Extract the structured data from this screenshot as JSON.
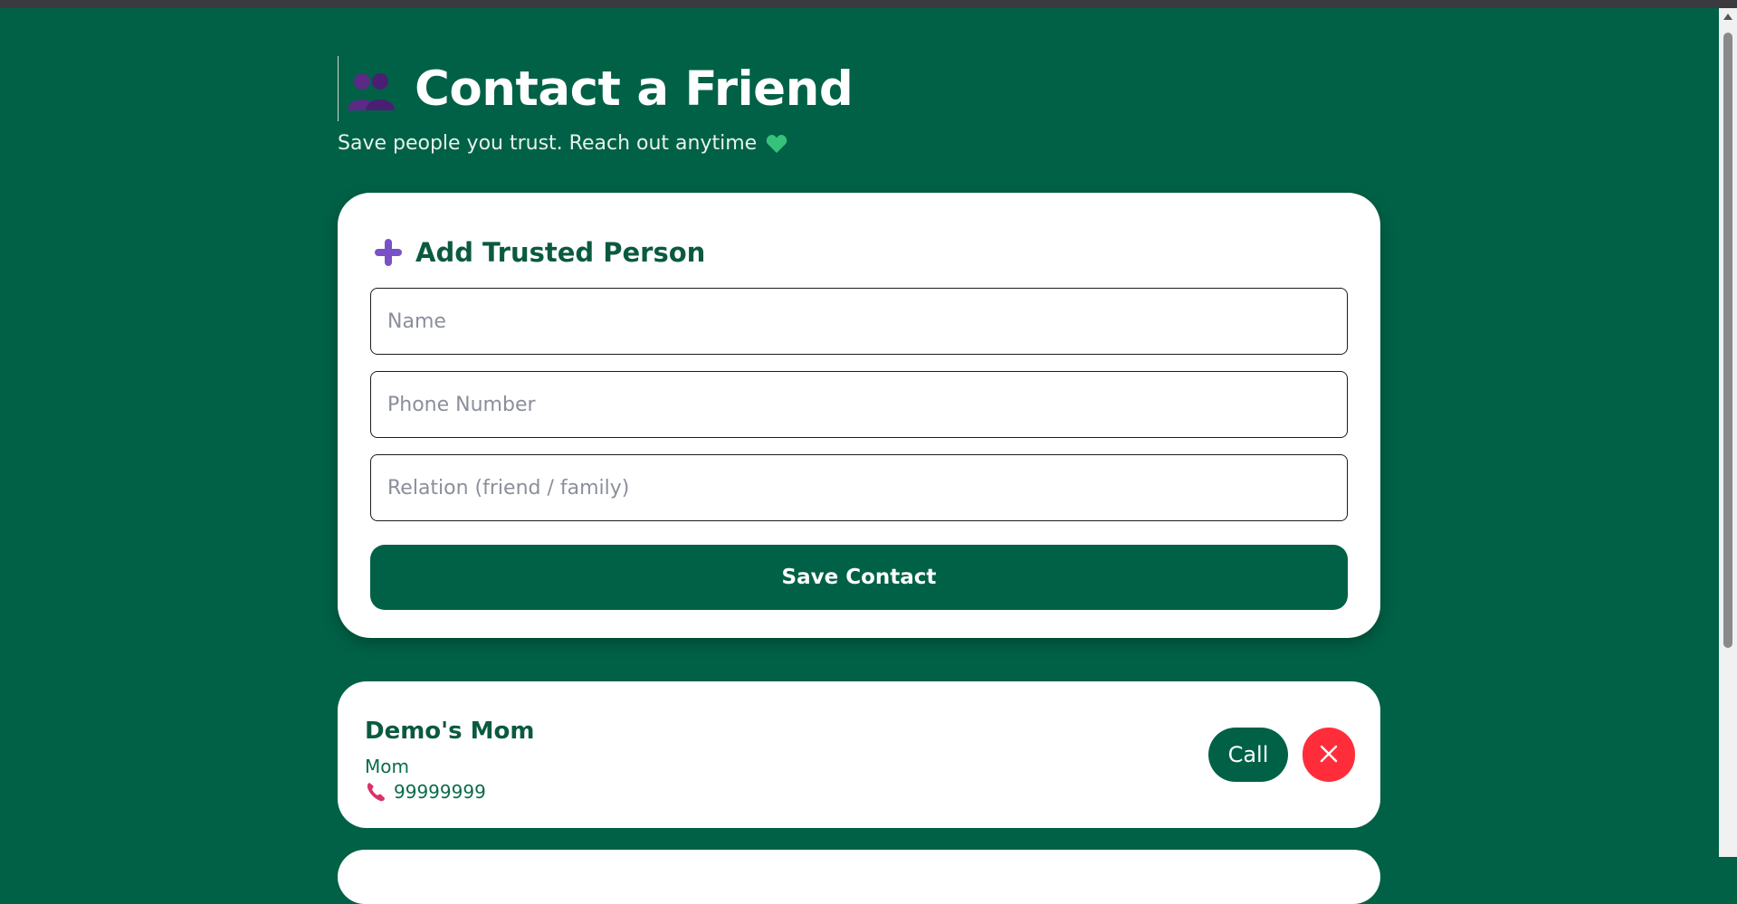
{
  "header": {
    "title": "Contact a Friend",
    "title_icon": "people-icon",
    "subtitle": "Save people you trust. Reach out anytime",
    "subtitle_icon": "green-heart-icon"
  },
  "form": {
    "title": "Add Trusted Person",
    "title_icon": "plus-icon",
    "name_placeholder": "Name",
    "name_value": "",
    "phone_placeholder": "Phone Number",
    "phone_value": "",
    "relation_placeholder": "Relation (friend / family)",
    "relation_value": "",
    "save_label": "Save Contact"
  },
  "contacts": [
    {
      "name": "Demo's Mom",
      "relation": "Mom",
      "phone": "99999999",
      "call_label": "Call",
      "phone_icon": "phone-icon",
      "delete_icon": "close-icon"
    }
  ],
  "colors": {
    "background": "#006146",
    "accent": "#006146",
    "delete": "#ff2d3a",
    "card": "#ffffff"
  }
}
